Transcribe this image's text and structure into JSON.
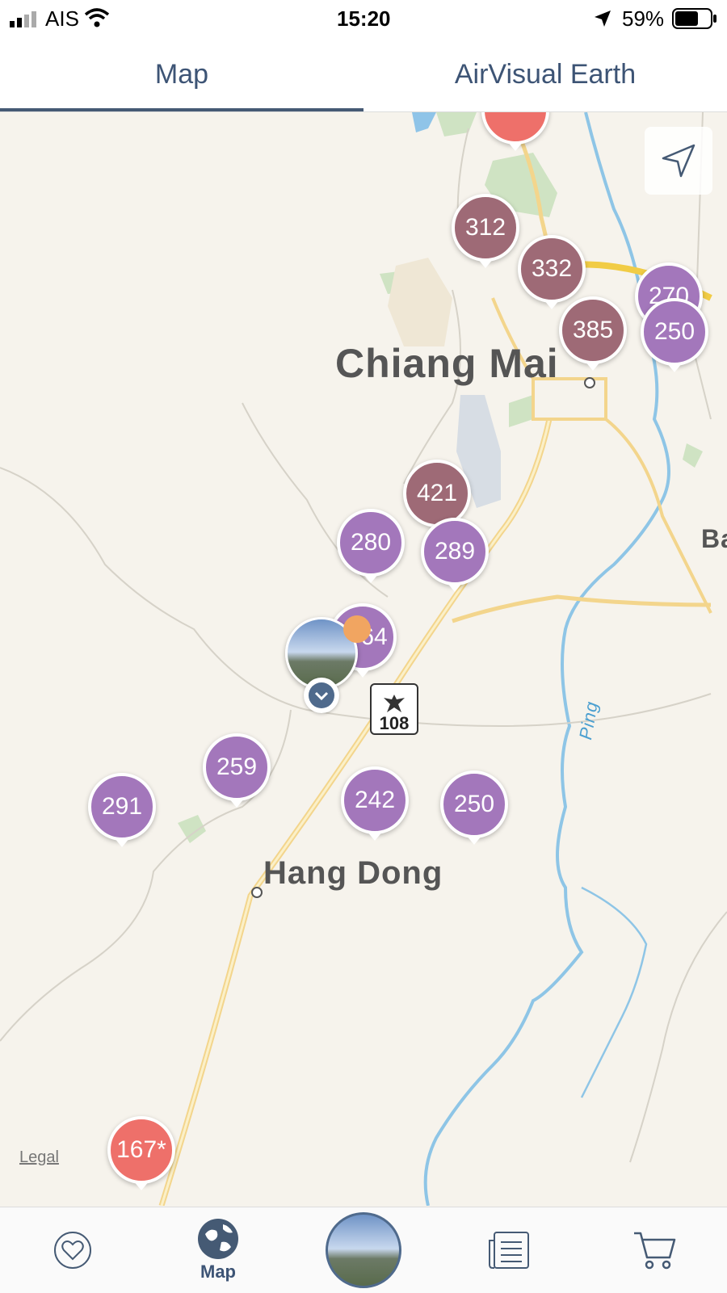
{
  "status_bar": {
    "carrier": "AIS",
    "time": "15:20",
    "battery": "59%"
  },
  "tabs": [
    {
      "label": "Map",
      "active": true
    },
    {
      "label": "AirVisual Earth",
      "active": false
    }
  ],
  "map": {
    "city_labels": {
      "chiang_mai": "Chiang Mai",
      "hang_dong": "Hang Dong",
      "ba": "Ba"
    },
    "river_label": "Ping",
    "highway_shield": "108",
    "legal": "Legal",
    "user_marker_value": "64",
    "markers": [
      "312",
      "332",
      "270",
      "385",
      "250",
      "421",
      "280",
      "289",
      "259",
      "291",
      "242",
      "250",
      "167*"
    ]
  },
  "bottom_nav": {
    "map_label": "Map"
  },
  "colors": {
    "purple": "#a377bb",
    "maroon": "#9e6a76",
    "red": "#ee706a",
    "accent": "#455a74"
  }
}
